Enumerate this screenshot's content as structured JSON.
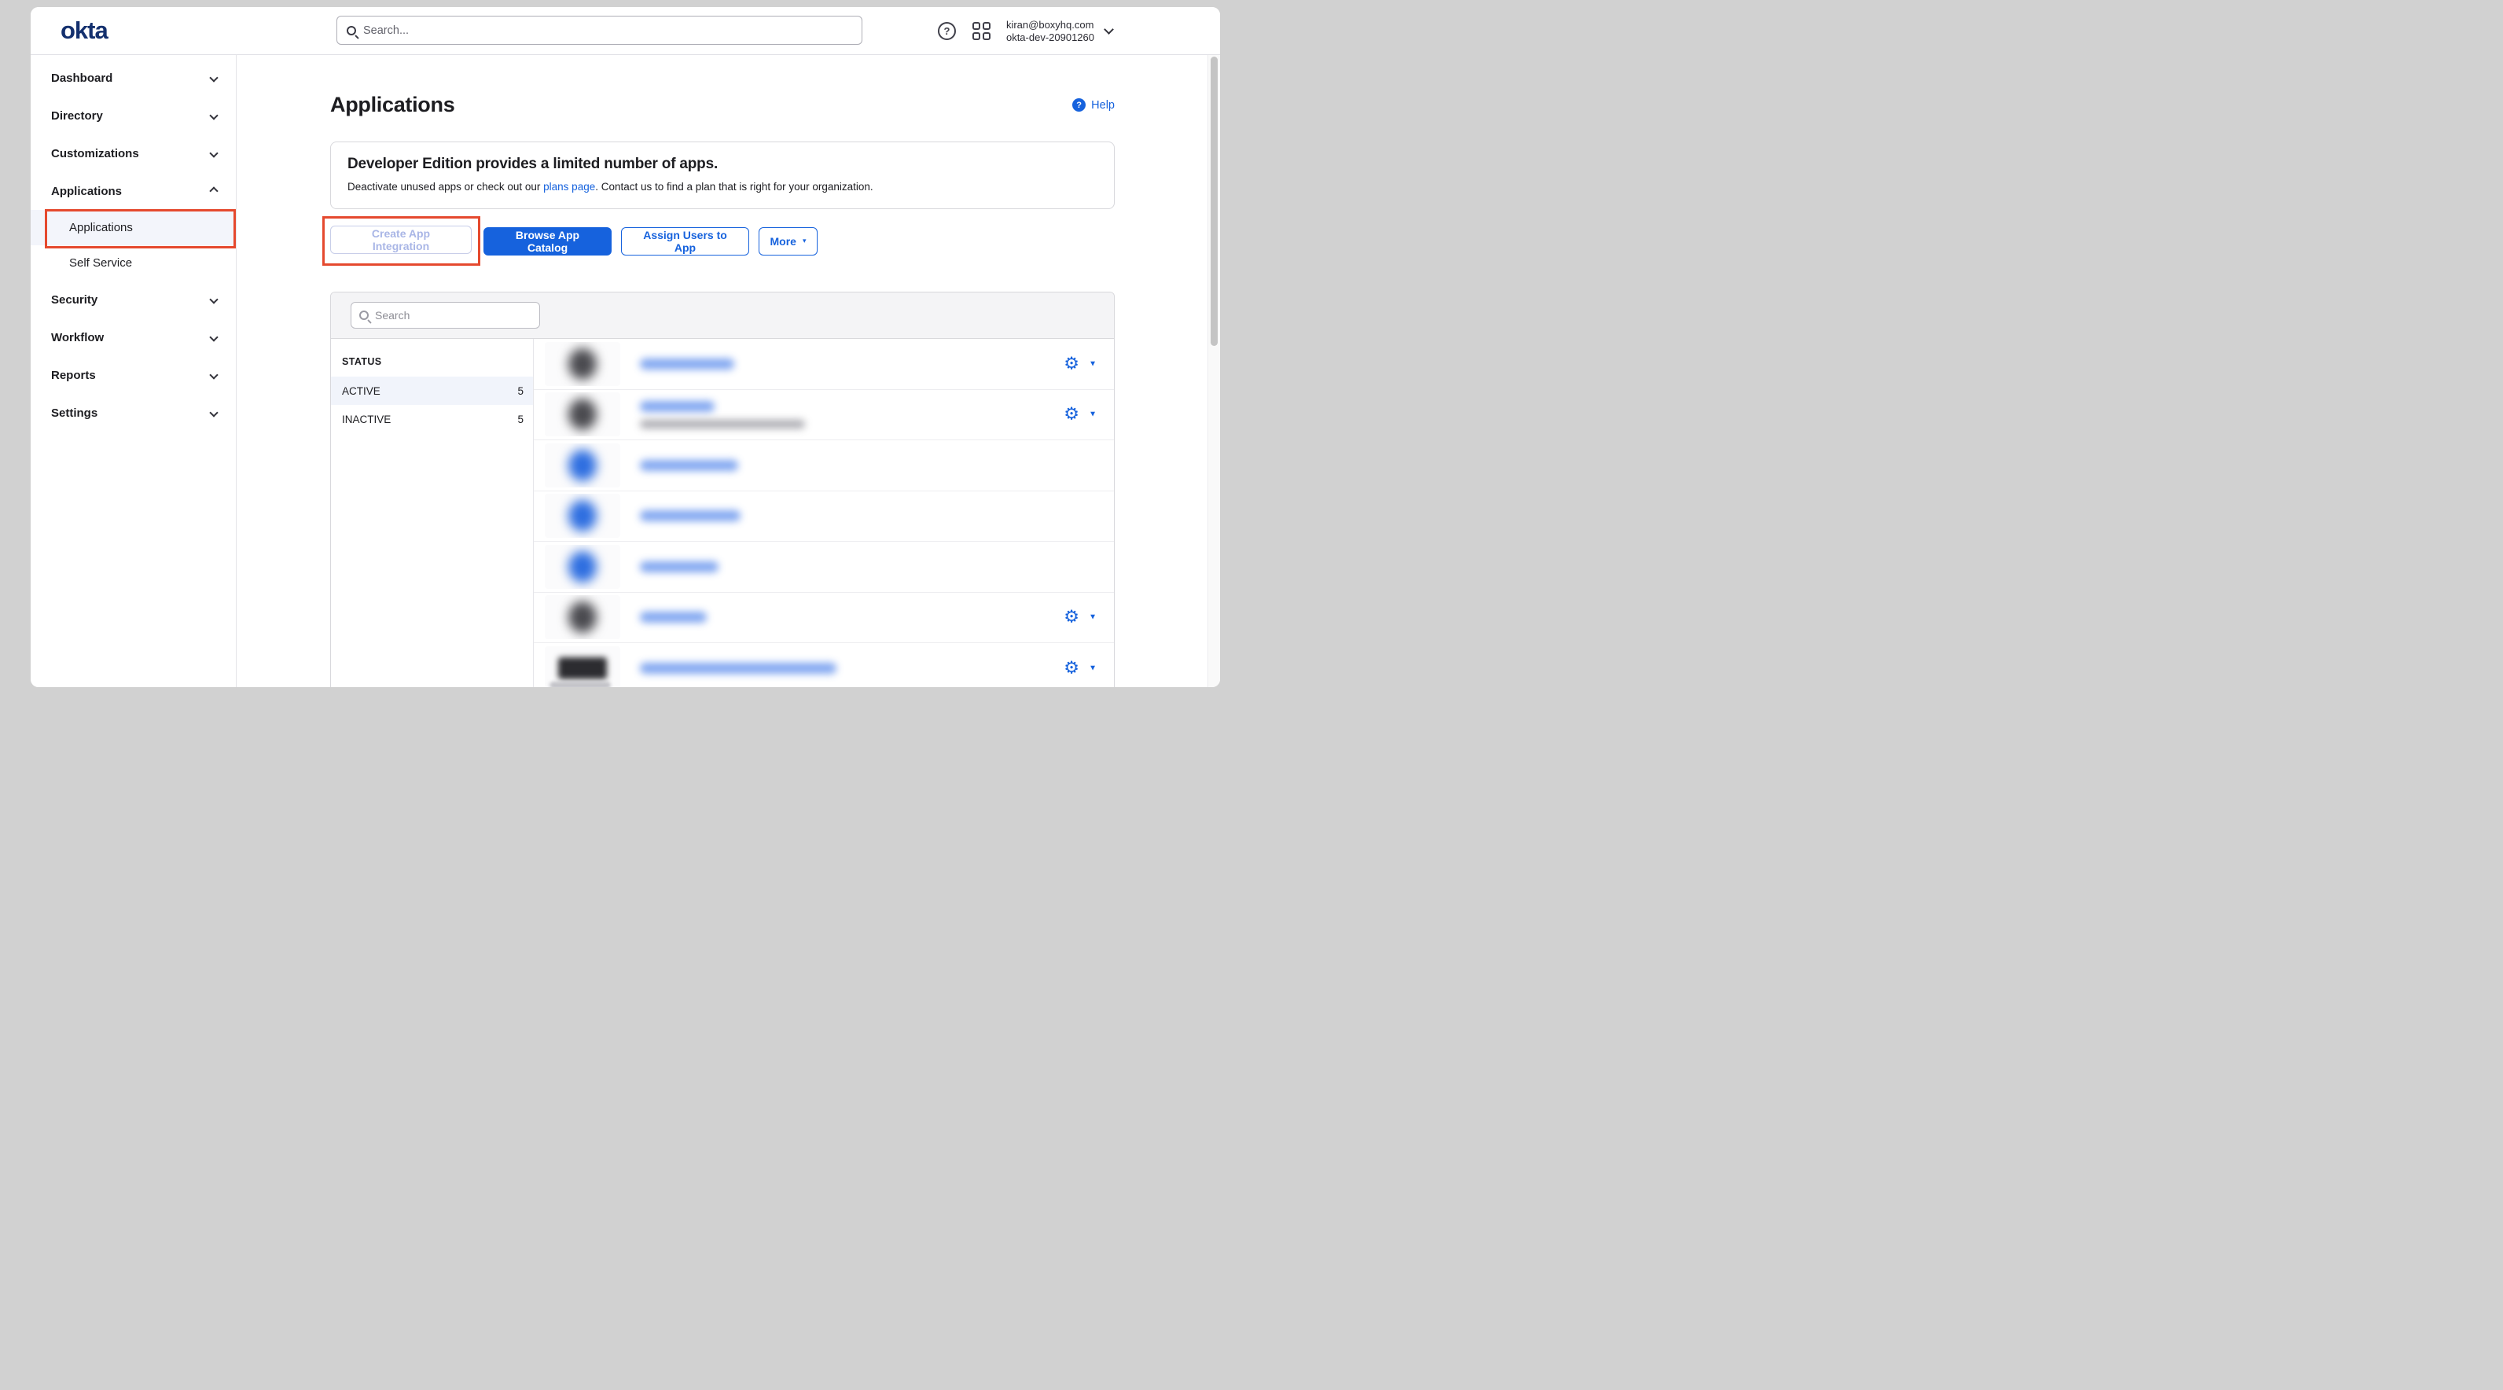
{
  "topbar": {
    "logo_text": "okta",
    "search_placeholder": "Search...",
    "account": {
      "email": "kiran@boxyhq.com",
      "org": "okta-dev-20901260"
    }
  },
  "sidebar": {
    "items": [
      {
        "label": "Dashboard",
        "expanded": false
      },
      {
        "label": "Directory",
        "expanded": false
      },
      {
        "label": "Customizations",
        "expanded": false
      },
      {
        "label": "Applications",
        "expanded": true,
        "children": [
          {
            "label": "Applications",
            "active": true,
            "annotated": true
          },
          {
            "label": "Self Service",
            "active": false
          }
        ]
      },
      {
        "label": "Security",
        "expanded": false
      },
      {
        "label": "Workflow",
        "expanded": false
      },
      {
        "label": "Reports",
        "expanded": false
      },
      {
        "label": "Settings",
        "expanded": false
      }
    ]
  },
  "page": {
    "title": "Applications",
    "help_label": "Help"
  },
  "banner": {
    "title": "Developer Edition provides a limited number of apps.",
    "body_before_link": "Deactivate unused apps or check out our ",
    "link_text": "plans page",
    "body_after_link": ". Contact us to find a plan that is right for your organization."
  },
  "actions": {
    "create_label": "Create App Integration",
    "create_disabled": true,
    "create_annotated": true,
    "browse_label": "Browse App Catalog",
    "assign_label": "Assign Users to App",
    "more_label": "More"
  },
  "app_list": {
    "search_placeholder": "Search",
    "filters": {
      "header": "STATUS",
      "items": [
        {
          "label": "ACTIVE",
          "count": 5,
          "selected": true
        },
        {
          "label": "INACTIVE",
          "count": 5,
          "selected": false
        }
      ]
    },
    "rows": [
      {
        "icon": "dark-round",
        "title_redacted": true,
        "title_width": 120,
        "has_subtitle": false,
        "has_settings": true
      },
      {
        "icon": "dark-round",
        "title_redacted": true,
        "title_width": 95,
        "has_subtitle": true,
        "subtitle_width": 210,
        "has_settings": true
      },
      {
        "icon": "blue-round",
        "title_redacted": true,
        "title_width": 125,
        "has_subtitle": false,
        "has_settings": false
      },
      {
        "icon": "blue-round",
        "title_redacted": true,
        "title_width": 128,
        "has_subtitle": false,
        "has_settings": false
      },
      {
        "icon": "blue-round",
        "title_redacted": true,
        "title_width": 100,
        "has_subtitle": false,
        "has_settings": false
      },
      {
        "icon": "dark-round",
        "title_redacted": true,
        "title_width": 85,
        "has_subtitle": false,
        "has_settings": true
      },
      {
        "icon": "scim-logo",
        "title_redacted": true,
        "title_width": 250,
        "has_subtitle": false,
        "has_settings": true
      },
      {
        "icon": "placeholder",
        "partial": true
      }
    ]
  },
  "colors": {
    "accent_blue": "#1662dd",
    "annotation_orange": "#e5492e",
    "logo_navy": "#14306e",
    "active_filter_bg": "#f1f4fb"
  }
}
